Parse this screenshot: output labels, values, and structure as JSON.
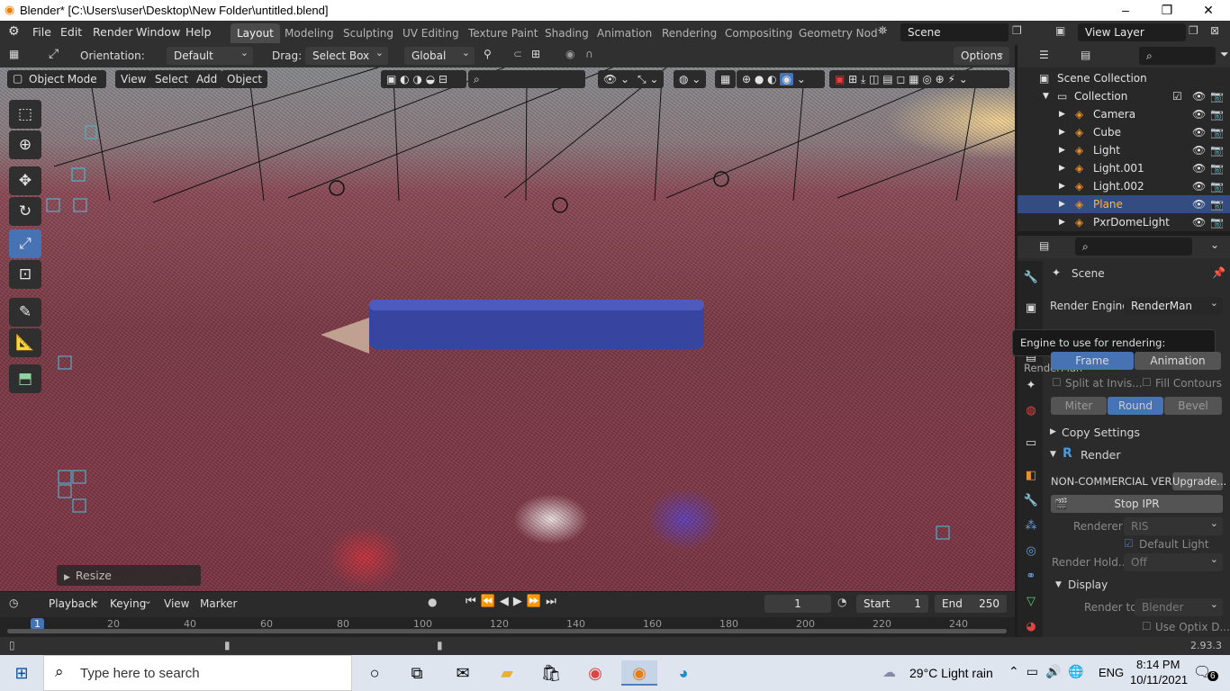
{
  "window": {
    "title": "Blender* [C:\\Users\\user\\Desktop\\New Folder\\untitled.blend]",
    "minimize": "–",
    "maximize": "❐",
    "close": "✕"
  },
  "menu": [
    "File",
    "Edit",
    "Render",
    "Window",
    "Help"
  ],
  "workspaces": [
    "Layout",
    "Modeling",
    "Sculpting",
    "UV Editing",
    "Texture Paint",
    "Shading",
    "Animation",
    "Rendering",
    "Compositing",
    "Geometry Nod"
  ],
  "scene_name": "Scene",
  "view_layer": "View Layer",
  "tool_header": {
    "orientation_label": "Orientation:",
    "orientation_value": "Default",
    "drag_label": "Drag:",
    "drag_value": "Select Box",
    "transform_orientation": "Global",
    "options": "Options"
  },
  "viewport_header": {
    "mode": "Object Mode",
    "view": "View",
    "select": "Select",
    "add": "Add",
    "object": "Object"
  },
  "redo_panel": "Resize",
  "outliner": {
    "root": "Scene Collection",
    "collection": "Collection",
    "items": [
      {
        "name": "Camera",
        "selected": false
      },
      {
        "name": "Cube",
        "selected": false
      },
      {
        "name": "Light",
        "selected": false
      },
      {
        "name": "Light.001",
        "selected": false
      },
      {
        "name": "Light.002",
        "selected": false
      },
      {
        "name": "Plane",
        "selected": true
      },
      {
        "name": "PxrDomeLight",
        "selected": false
      }
    ]
  },
  "properties": {
    "context": "Scene",
    "render_engine_label": "Render Engine",
    "render_engine_value": "RenderMan",
    "tooltip": "Engine to use for rendering:",
    "tooltip_value": "RenderMan",
    "frame_btn": "Frame",
    "animation_btn": "Animation",
    "split_at_invis": "Split at Invis...",
    "fill_contours": "Fill Contours",
    "miter": "Miter",
    "round": "Round",
    "bevel": "Bevel",
    "copy_settings": "Copy Settings",
    "render_section": "Render",
    "noncommercial": "NON-COMMERCIAL VER...",
    "upgrade": "Upgrade...",
    "stop_ipr": "Stop IPR",
    "renderer_label": "Renderer",
    "renderer_value": "RIS",
    "default_light": "Default Light",
    "render_hold_label": "Render Hold...",
    "render_hold_value": "Off",
    "display_section": "Display",
    "render_to_label": "Render to",
    "render_to_value": "Blender",
    "use_optix": "Use Optix D..."
  },
  "timeline": {
    "playback": "Playback",
    "keying": "Keying",
    "view": "View",
    "marker": "Marker",
    "current_frame": "1",
    "start_label": "Start",
    "start_value": "1",
    "end_label": "End",
    "end_value": "250",
    "ruler": [
      "1",
      "20",
      "40",
      "60",
      "80",
      "100",
      "120",
      "140",
      "160",
      "180",
      "200",
      "220",
      "240"
    ]
  },
  "status": {
    "version": "2.93.3"
  },
  "taskbar": {
    "search_placeholder": "Type here to search",
    "weather": "29°C  Light rain",
    "language": "ENG",
    "time": "8:14 PM",
    "date": "10/11/2021",
    "notifications": "6"
  },
  "colors": {
    "accent": "#4772b3",
    "selected_row": "#334d80",
    "stop_ipr_red": "#c0392b"
  }
}
